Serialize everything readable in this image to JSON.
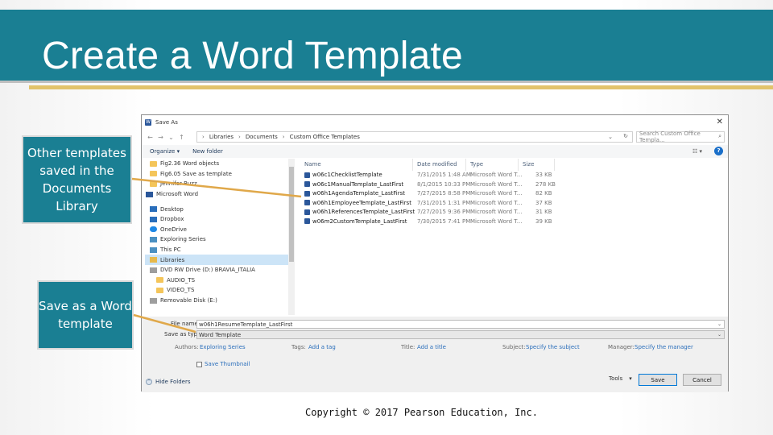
{
  "slide": {
    "title": "Create a Word Template",
    "copyright": "Copyright © 2017 Pearson Education, Inc.",
    "callouts": [
      "Other templates saved in the Documents Library",
      "Save as a Word template"
    ],
    "colors": {
      "title_bar": "#1a7f93",
      "accent": "#e2c36b",
      "leader_line": "#e0a84a"
    }
  },
  "dialog": {
    "title": "Save As",
    "close_glyph": "✕",
    "nav": {
      "back": "←",
      "forward": "→",
      "up_menu": "⌄",
      "up": "↑"
    },
    "breadcrumb": [
      "Libraries",
      "Documents",
      "Custom Office Templates"
    ],
    "breadcrumb_sep": "›",
    "search_placeholder": "Search Custom Office Templa...",
    "search_icon": "search-icon",
    "toolbar": {
      "organize": "Organize ▾",
      "new_folder": "New folder",
      "view_glyph": "☷ ▾",
      "help_glyph": "?"
    },
    "nav_pane": [
      {
        "label": "Fig2.36 Word objects",
        "icon": "folder"
      },
      {
        "label": "Fig6.05 Save as template",
        "icon": "folder"
      },
      {
        "label": "Jennifer Buzz",
        "icon": "folder"
      },
      {
        "label": "Microsoft Word",
        "icon": "wordi"
      },
      {
        "label": "Desktop",
        "icon": "blue-ico"
      },
      {
        "label": "Dropbox",
        "icon": "blue-ico"
      },
      {
        "label": "OneDrive",
        "icon": "cloud"
      },
      {
        "label": "Exploring Series",
        "icon": "pc"
      },
      {
        "label": "This PC",
        "icon": "pc"
      },
      {
        "label": "Libraries",
        "icon": "lib",
        "selected": true
      },
      {
        "label": "DVD RW Drive (D:) BRAVIA_ITALIA",
        "icon": "disk"
      },
      {
        "label": "AUDIO_TS",
        "icon": "folder"
      },
      {
        "label": "VIDEO_TS",
        "icon": "folder"
      },
      {
        "label": "Removable Disk (E:)",
        "icon": "disk"
      }
    ],
    "columns": {
      "name": "Name",
      "date": "Date modified",
      "type": "Type",
      "size": "Size"
    },
    "files": [
      {
        "name": "w06c1ChecklistTemplate",
        "date": "7/31/2015 1:48 AM",
        "type": "Microsoft Word T...",
        "size": "33 KB"
      },
      {
        "name": "w06c1ManualTemplate_LastFirst",
        "date": "8/1/2015 10:33 PM",
        "type": "Microsoft Word T...",
        "size": "278 KB"
      },
      {
        "name": "w06h1AgendaTemplate_LastFirst",
        "date": "7/27/2015 8:58 PM",
        "type": "Microsoft Word T...",
        "size": "82 KB"
      },
      {
        "name": "w06h1EmployeeTemplate_LastFirst",
        "date": "7/31/2015 1:31 PM",
        "type": "Microsoft Word T...",
        "size": "37 KB"
      },
      {
        "name": "w06h1ReferencesTemplate_LastFirst",
        "date": "7/27/2015 9:36 PM",
        "type": "Microsoft Word T...",
        "size": "31 KB"
      },
      {
        "name": "w06m2CustomTemplate_LastFirst",
        "date": "7/30/2015 7:41 PM",
        "type": "Microsoft Word T...",
        "size": "39 KB"
      }
    ],
    "form": {
      "file_name_label": "File name:",
      "file_name_value": "w06h1ResumeTemplate_LastFirst",
      "save_type_label": "Save as type:",
      "save_type_value": "Word Template",
      "dropdown_glyph": "⌄",
      "authors_label": "Authors:",
      "authors_value": "Exploring Series",
      "tags_label": "Tags:",
      "tags_value": "Add a tag",
      "title_label": "Title:",
      "title_value": "Add a title",
      "subject_label": "Subject:",
      "subject_value": "Specify the subject",
      "manager_label": "Manager:",
      "manager_value": "Specify the manager",
      "thumbnail_label": "Save Thumbnail",
      "hide_folders": "Hide Folders",
      "hide_glyph": "^",
      "tools": "Tools",
      "tools_glyph": "▾",
      "save": "Save",
      "cancel": "Cancel"
    }
  }
}
